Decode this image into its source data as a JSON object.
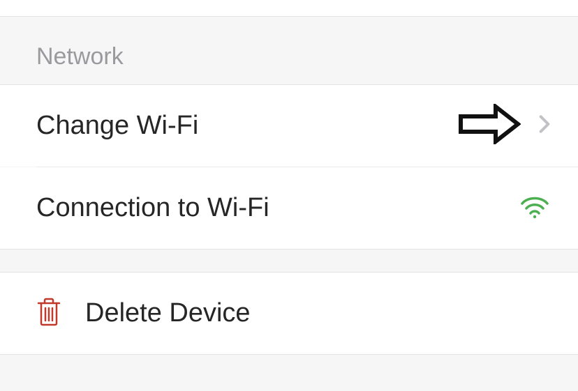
{
  "network": {
    "header": "Network",
    "change_wifi_label": "Change Wi-Fi",
    "connection_label": "Connection to Wi-Fi"
  },
  "actions": {
    "delete_label": "Delete Device"
  }
}
